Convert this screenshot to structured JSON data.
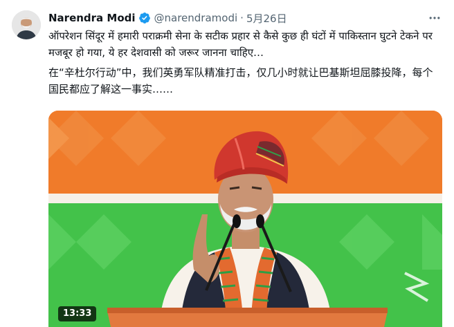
{
  "tweet": {
    "author_name": "Narendra Modi",
    "handle": "@narendramodi",
    "separator": "·",
    "date": "5月26日",
    "text_hindi": "ऑपरेशन सिंदूर में हमारी पराक्रमी सेना के सटीक प्रहार से कैसे कुछ ही घंटों में पाकिस्तान घुटने टेकने पर मजबूर हो गया, ये हर देशवासी को जरूर जानना चाहिए…",
    "text_chinese": "在“辛杜尔行动”中，我们英勇军队精准打击，仅几小时就让巴基斯坦屈膝投降，每个国民都应了解这一事实……"
  },
  "video": {
    "duration": "13:33"
  },
  "icons": {
    "verified": "verified-badge-icon",
    "more": "more-options-icon"
  },
  "colors": {
    "verified_badge": "#1d9bf0",
    "secondary_text": "#536471",
    "backdrop_orange": "#f07b2a",
    "backdrop_green": "#43c24a",
    "turban_red": "#d0372e",
    "podium": "#e2793f"
  }
}
